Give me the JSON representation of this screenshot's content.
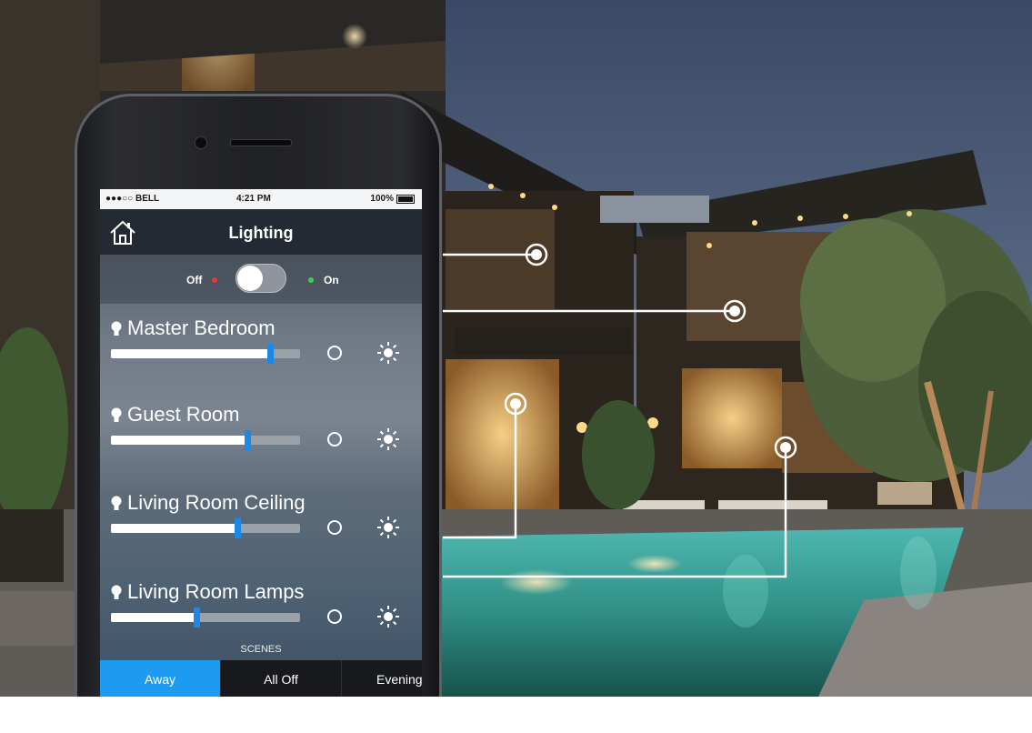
{
  "colors": {
    "accent": "#1d9bf0",
    "slider_thumb": "#1e88e5",
    "off_indicator": "#e53935",
    "on_indicator": "#35d34a"
  },
  "status_bar": {
    "carrier": "●●●○○ BELL",
    "time": "4:21 PM",
    "battery": "100%"
  },
  "header": {
    "title": "Lighting",
    "home_icon": "home-icon"
  },
  "master_switch": {
    "off_label": "Off",
    "on_label": "On",
    "state": "off"
  },
  "rooms": [
    {
      "name": "Master Bedroom",
      "level": 0.84
    },
    {
      "name": "Guest Room",
      "level": 0.72
    },
    {
      "name": "Living Room Ceiling",
      "level": 0.67
    },
    {
      "name": "Living Room Lamps",
      "level": 0.45
    }
  ],
  "scenes": {
    "label": "SCENES",
    "items": [
      {
        "label": "Away",
        "active": true
      },
      {
        "label": "All Off",
        "active": false
      },
      {
        "label": "Evening",
        "active": false
      }
    ]
  }
}
